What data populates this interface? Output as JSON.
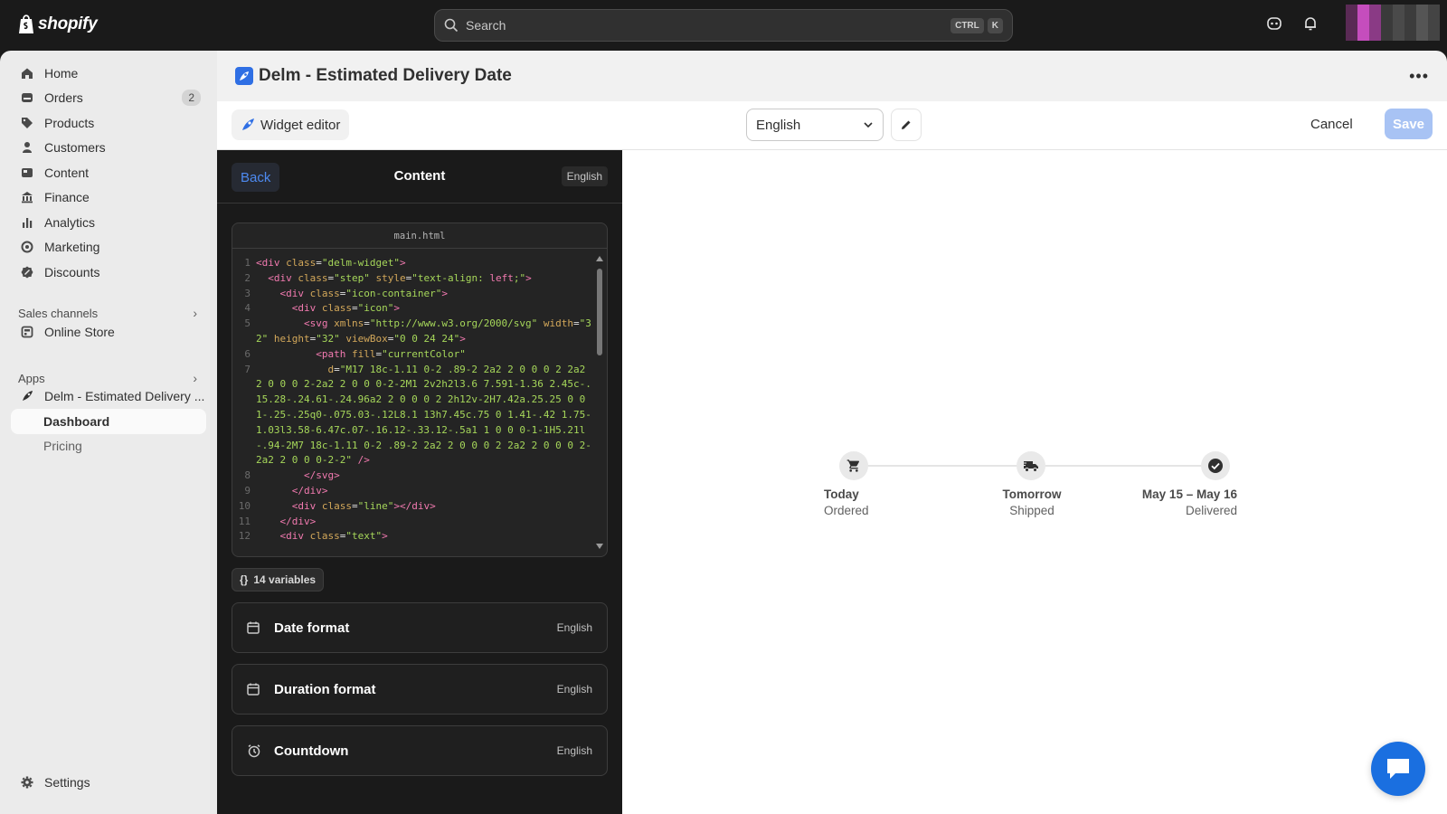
{
  "topbar": {
    "brand": "shopify",
    "search_placeholder": "Search",
    "shortcut_ctrl": "CTRL",
    "shortcut_key": "K"
  },
  "sidebar": {
    "items": [
      {
        "label": "Home",
        "icon": "home-icon"
      },
      {
        "label": "Orders",
        "icon": "orders-icon",
        "badge": "2"
      },
      {
        "label": "Products",
        "icon": "tag-icon"
      },
      {
        "label": "Customers",
        "icon": "person-icon"
      },
      {
        "label": "Content",
        "icon": "content-icon"
      },
      {
        "label": "Finance",
        "icon": "bank-icon"
      },
      {
        "label": "Analytics",
        "icon": "bar-chart-icon"
      },
      {
        "label": "Marketing",
        "icon": "target-icon"
      },
      {
        "label": "Discounts",
        "icon": "discount-icon"
      }
    ],
    "sales_channels_label": "Sales channels",
    "online_store": "Online Store",
    "apps_label": "Apps",
    "app_name": "Delm - Estimated Delivery ...",
    "dashboard": "Dashboard",
    "pricing": "Pricing",
    "settings": "Settings"
  },
  "page": {
    "title": "Delm - Estimated Delivery Date",
    "widget_editor": "Widget editor",
    "language": "English",
    "cancel": "Cancel",
    "save": "Save"
  },
  "editor": {
    "back": "Back",
    "title": "Content",
    "lang": "English",
    "filename": "main.html",
    "variables": "14 variables",
    "cards": [
      {
        "label": "Date format",
        "lang": "English",
        "icon": "calendar-icon"
      },
      {
        "label": "Duration format",
        "lang": "English",
        "icon": "calendar-icon"
      },
      {
        "label": "Countdown",
        "lang": "English",
        "icon": "alarm-clock-icon"
      }
    ]
  },
  "code": [
    {
      "n": "1",
      "segs": [
        [
          "t",
          "<div "
        ],
        [
          "a",
          "class"
        ],
        [
          "p",
          "="
        ],
        [
          "s",
          "\"delm-widget\""
        ],
        [
          "t",
          ">"
        ]
      ]
    },
    {
      "n": "2",
      "segs": [
        [
          "p",
          "  "
        ],
        [
          "t",
          "<div "
        ],
        [
          "a",
          "class"
        ],
        [
          "p",
          "="
        ],
        [
          "s",
          "\"step\" "
        ],
        [
          "a",
          "style"
        ],
        [
          "p",
          "="
        ],
        [
          "s",
          "\"text-align: "
        ],
        [
          "t",
          "left"
        ],
        [
          "s",
          ";\""
        ],
        [
          "t",
          ">"
        ]
      ]
    },
    {
      "n": "3",
      "segs": [
        [
          "p",
          "    "
        ],
        [
          "t",
          "<div "
        ],
        [
          "a",
          "class"
        ],
        [
          "p",
          "="
        ],
        [
          "s",
          "\"icon-container\""
        ],
        [
          "t",
          ">"
        ]
      ]
    },
    {
      "n": "4",
      "segs": [
        [
          "p",
          "      "
        ],
        [
          "t",
          "<div "
        ],
        [
          "a",
          "class"
        ],
        [
          "p",
          "="
        ],
        [
          "s",
          "\"icon\""
        ],
        [
          "t",
          ">"
        ]
      ]
    },
    {
      "n": "5",
      "segs": [
        [
          "p",
          "        "
        ],
        [
          "t",
          "<svg "
        ],
        [
          "a",
          "xmlns"
        ],
        [
          "p",
          "="
        ],
        [
          "s",
          "\"http://www.w3.org/2000/svg\" "
        ],
        [
          "a",
          "width"
        ],
        [
          "p",
          "="
        ],
        [
          "s",
          "\"32\" "
        ],
        [
          "a",
          "height"
        ],
        [
          "p",
          "="
        ],
        [
          "s",
          "\"32\" "
        ],
        [
          "a",
          "viewBox"
        ],
        [
          "p",
          "="
        ],
        [
          "s",
          "\"0 0 24 24\""
        ],
        [
          "t",
          ">"
        ]
      ]
    },
    {
      "n": "6",
      "segs": [
        [
          "p",
          "          "
        ],
        [
          "t",
          "<path "
        ],
        [
          "a",
          "fill"
        ],
        [
          "p",
          "="
        ],
        [
          "s",
          "\"currentColor\""
        ]
      ]
    },
    {
      "n": "7",
      "segs": [
        [
          "p",
          "            "
        ],
        [
          "a",
          "d"
        ],
        [
          "p",
          "="
        ],
        [
          "s",
          "\"M17 18c-1.11 0-2 .89-2 2a2 2 0 0 0 2 2a2 2 0 0 0 2-2a2 2 0 0 0-2-2M1 2v2h2l3.6 7.591-1.36 2.45c-.15.28-.24.61-.24.96a2 2 0 0 0 2 2h12v-2H7.42a.25.25 0 0 1-.25-.25q0-.075.03-.12L8.1 13h7.45c.75 0 1.41-.42 1.75-1.03l3.58-6.47c.07-.16.12-.33.12-.5a1 1 0 0 0-1-1H5.21l-.94-2M7 18c-1.11 0-2 .89-2 2a2 2 0 0 0 2 2a2 2 0 0 0 2-2a2 2 0 0 0-2-2\" "
        ],
        [
          "t",
          "/>"
        ]
      ]
    },
    {
      "n": "8",
      "segs": [
        [
          "p",
          "        "
        ],
        [
          "t",
          "</svg>"
        ]
      ]
    },
    {
      "n": "9",
      "segs": [
        [
          "p",
          "      "
        ],
        [
          "t",
          "</div>"
        ]
      ]
    },
    {
      "n": "10",
      "segs": [
        [
          "p",
          "      "
        ],
        [
          "t",
          "<div "
        ],
        [
          "a",
          "class"
        ],
        [
          "p",
          "="
        ],
        [
          "s",
          "\"line\""
        ],
        [
          "t",
          "></div>"
        ]
      ]
    },
    {
      "n": "11",
      "segs": [
        [
          "p",
          "    "
        ],
        [
          "t",
          "</div>"
        ]
      ]
    },
    {
      "n": "12",
      "segs": [
        [
          "p",
          "    "
        ],
        [
          "t",
          "<div "
        ],
        [
          "a",
          "class"
        ],
        [
          "p",
          "="
        ],
        [
          "s",
          "\"text\""
        ],
        [
          "t",
          ">"
        ]
      ]
    }
  ],
  "preview": {
    "steps": [
      {
        "title": "Today",
        "sub": "Ordered",
        "icon": "cart-icon"
      },
      {
        "title": "Tomorrow",
        "sub": "Shipped",
        "icon": "truck-icon"
      },
      {
        "title": "May 15 – May 16",
        "sub": "Delivered",
        "icon": "check-circle-icon"
      }
    ]
  },
  "colors": {
    "accent": "#1a6fe0",
    "save_disabled": "#a8c3f4",
    "editor_bg": "#1a1a1a"
  }
}
